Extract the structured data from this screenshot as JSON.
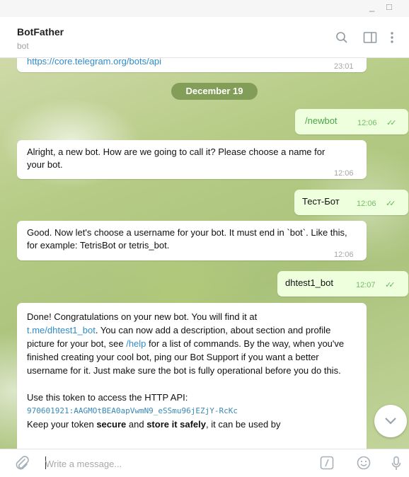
{
  "window": {
    "minimize": "_",
    "maximize": "□"
  },
  "header": {
    "title": "BotFather",
    "subtitle": "bot"
  },
  "cut_message": {
    "link_text": "https://core.telegram.org/bots/api",
    "time": "23:01"
  },
  "date_separator": "December 19",
  "messages": [
    {
      "direction": "out",
      "text": "/newbot",
      "time": "12:06",
      "is_command": true
    },
    {
      "direction": "in",
      "text": "Alright, a new bot. How are we going to call it? Please choose a name for your bot.",
      "time": "12:06"
    },
    {
      "direction": "out",
      "text": "Тест-Бот",
      "time": "12:06"
    },
    {
      "direction": "in",
      "text": "Good. Now let's choose a username for your bot. It must end in `bot`. Like this, for example: TetrisBot or tetris_bot.",
      "time": "12:06"
    },
    {
      "direction": "out",
      "text": "dhtest1_bot",
      "time": "12:07"
    },
    {
      "direction": "in",
      "p1": "Done! Congratulations on your new bot. You will find it at",
      "link": "t.me/dhtest1_bot",
      "p2": ". You can now add a description, about section and profile picture for your bot, see",
      "help": "/help",
      "p3": "for a list of commands. By the way, when you've finished creating your cool bot, ping our Bot Support if you want a better username for it. Just make sure the bot is fully operational before you do this.",
      "p4": "Use this token to access the HTTP API:",
      "token": "970601921:AAGMOtBEA0apVwmN9_eSSmu96jEZjY-RcKc",
      "p5a": "Keep your token",
      "p5b": "secure",
      "p5c": "and",
      "p5d": "store it safely",
      "p5e": ", it can be used by"
    }
  ],
  "composer": {
    "placeholder": "Write a message..."
  },
  "colors": {
    "outgoing_bubble": "#eeffde",
    "link": "#2f8cc9",
    "check": "#5fb85a",
    "date_pill": "#6e8c46"
  }
}
